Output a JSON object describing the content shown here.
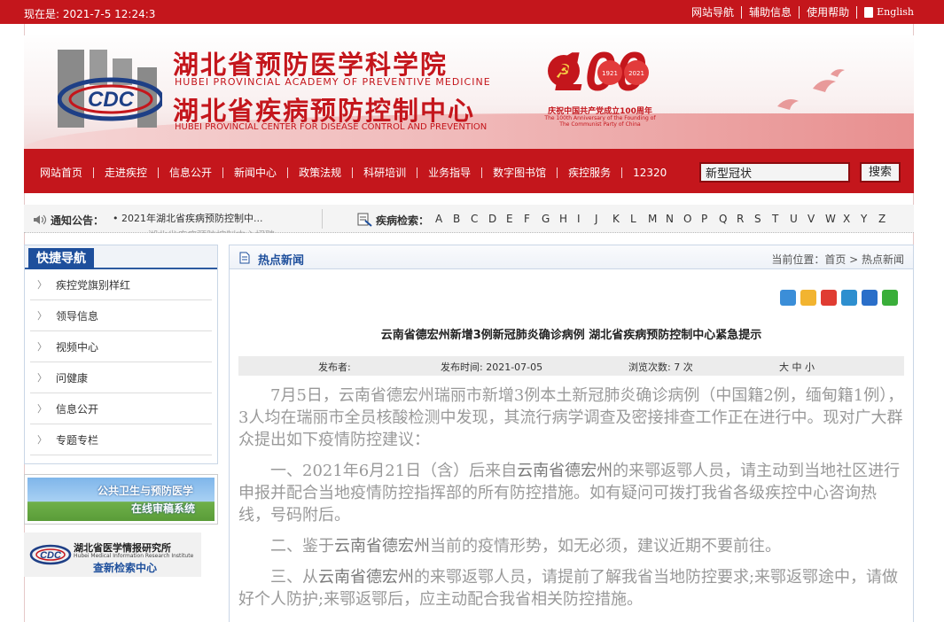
{
  "topbar": {
    "time": "现在是: 2021-7-5 12:24:3",
    "links": [
      "网站导航",
      "辅助信息",
      "使用帮助",
      "English"
    ]
  },
  "header": {
    "title_cn_1": "湖北省预防医学科学院",
    "title_en_1": "HUBEI PROVINCIAL ACADEMY OF PREVENTIVE MEDICINE",
    "title_cn_2": "湖北省疾病预防控制中心",
    "title_en_2": "HUBEI PROVINCIAL CENTER FOR DISEASE CONTROL AND PREVENTION",
    "logo_text": "CDC",
    "anniversary": {
      "number": "100",
      "year_left": "1921",
      "year_right": "2021",
      "line1": "庆祝中国共产党成立100周年",
      "line2": "The 100th Anniversary of the Founding of The Communist Party of China"
    }
  },
  "nav": {
    "items": [
      "网站首页",
      "走进疾控",
      "信息公开",
      "新闻中心",
      "政策法规",
      "科研培训",
      "业务指导",
      "数字图书馆",
      "疾控服务",
      "12320"
    ],
    "search_value": "新型冠状",
    "search_button": "搜索"
  },
  "notice": {
    "label": "通知公告：",
    "item": "• 2021年湖北省疾病预防控制中...",
    "item2": "• 湖北省疾病预防控制中心招聘",
    "search_label": "疾病检索：",
    "letters": [
      "A",
      "B",
      "C",
      "D",
      "E",
      "F",
      "G",
      "H",
      "I",
      "J",
      "K",
      "L",
      "M",
      "N",
      "O",
      "P",
      "Q",
      "R",
      "S",
      "T",
      "U",
      "V",
      "W",
      "X",
      "Y",
      "Z"
    ]
  },
  "sidebar": {
    "title": "快捷导航",
    "items": [
      "疾控党旗别样红",
      "领导信息",
      "视频中心",
      "问健康",
      "信息公开",
      "专题专栏"
    ]
  },
  "ads": {
    "ad1_line1": "公共卫生与预防医学",
    "ad1_line2": "在线审稿系统",
    "ad2_line1": "湖北省医学情报研究所",
    "ad2_line2": "Hubei Medical Information Research Institute",
    "ad2_line3": "查新检索中心"
  },
  "main": {
    "section_title": "热点新闻",
    "breadcrumb": "当前位置：首页 > 热点新闻",
    "article_title": "云南省德宏州新增3例新冠肺炎确诊病例 湖北省疾病预防控制中心紧急提示",
    "meta": {
      "publisher": "发布者:",
      "date": "发布时间: 2021-07-05",
      "views": "浏览次数: 7 次",
      "font_size": "大 中 小"
    },
    "paragraphs": {
      "p1": "7月5日，云南省德宏州瑞丽市新增3例本土新冠肺炎确诊病例（中国籍2例，缅甸籍1例），3人均在瑞丽市全员核酸检测中发现，其流行病学调查及密接排查工作正在进行中。现对广大群众提出如下疫情防控建议：",
      "p2_a": "一、2021年6月21日（含）后来自",
      "p2_hl": "云南省德宏州",
      "p2_b": "的来鄂返鄂人员，请主动到当地社区进行申报并配合当地疫情防控指挥部的所有防控措施。如有疑问可拨打我省各级疾控中心咨询热线，号码附后。",
      "p3_a": "二、鉴于",
      "p3_hl": "云南省德宏州",
      "p3_b": "当前的疫情形势，如无必须，建议近期不要前往。",
      "p4_a": "三、从",
      "p4_hl": "云南省德宏州",
      "p4_b": "的来鄂返鄂人员，请提前了解我省当地防控要求;来鄂返鄂途中，请做好个人防护;来鄂返鄂后，应主动配合我省相关防控措施。"
    }
  },
  "colors": {
    "brand_red": "#c4161c",
    "nav_blue": "#1e4f9c"
  }
}
